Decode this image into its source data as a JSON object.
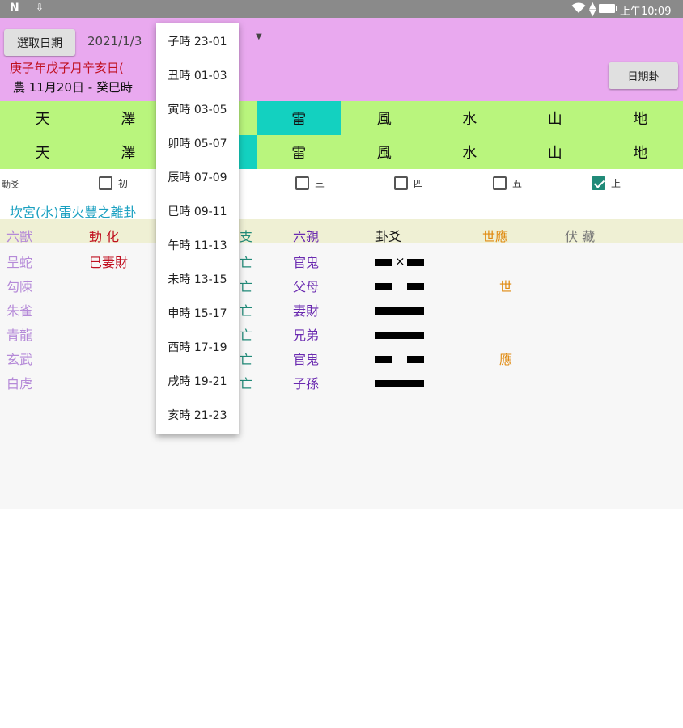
{
  "status_bar": {
    "time": "上午10:09"
  },
  "header": {
    "pick_date_label": "選取日期",
    "date_value": "2021/1/3",
    "ganzhi": "庚子年戊子月辛亥日(",
    "lunar": "農 11月20日 - 癸巳時",
    "date_gua_label": "日期卦"
  },
  "trigrams": {
    "upper": [
      "天",
      "澤",
      "",
      "雷",
      "風",
      "水",
      "山",
      "地"
    ],
    "lower": [
      "天",
      "澤",
      "",
      "雷",
      "風",
      "水",
      "山",
      "地"
    ]
  },
  "yao_row": {
    "label": "動爻",
    "items": [
      {
        "label": "初",
        "checked": false
      },
      {
        "label": "三",
        "checked": false
      },
      {
        "label": "四",
        "checked": false
      },
      {
        "label": "五",
        "checked": false
      },
      {
        "label": "上",
        "checked": true
      }
    ]
  },
  "gua_name": "坎宮(水)雷火豐之離卦",
  "table": {
    "headers": {
      "beast": "六獸",
      "change": "動  化",
      "left": "支",
      "qin": "六親",
      "yao": "卦爻",
      "shi": "世應",
      "fu": "伏  藏"
    },
    "rows": [
      {
        "beast": "呈蛇",
        "change": "巳妻財",
        "left": "亡",
        "qin": "官鬼",
        "line": "yin-moving",
        "shi": ""
      },
      {
        "beast": "勾陳",
        "change": "",
        "left": "亡",
        "qin": "父母",
        "line": "yin",
        "shi": "世"
      },
      {
        "beast": "朱雀",
        "change": "",
        "left": "亡",
        "qin": "妻財",
        "line": "yang",
        "shi": ""
      },
      {
        "beast": "青龍",
        "change": "",
        "left": "亡",
        "qin": "兄弟",
        "line": "yang",
        "shi": ""
      },
      {
        "beast": "玄武",
        "change": "",
        "left": "亡",
        "qin": "官鬼",
        "line": "yin",
        "shi": "應"
      },
      {
        "beast": "白虎",
        "change": "",
        "left": "亡",
        "qin": "子孫",
        "line": "yang",
        "shi": ""
      }
    ]
  },
  "dropdown": {
    "items": [
      "子時 23-01",
      "丑時 01-03",
      "寅時 03-05",
      "卯時 05-07",
      "辰時 07-09",
      "巳時 09-11",
      "午時 11-13",
      "未時 13-15",
      "申時 15-17",
      "酉時 17-19",
      "戌時 19-21",
      "亥時 21-23"
    ]
  },
  "colors": {
    "header_bg": "#e9a9ef",
    "trigram_bg": "#b9f57d",
    "selected_cell": "#13d1c0"
  }
}
